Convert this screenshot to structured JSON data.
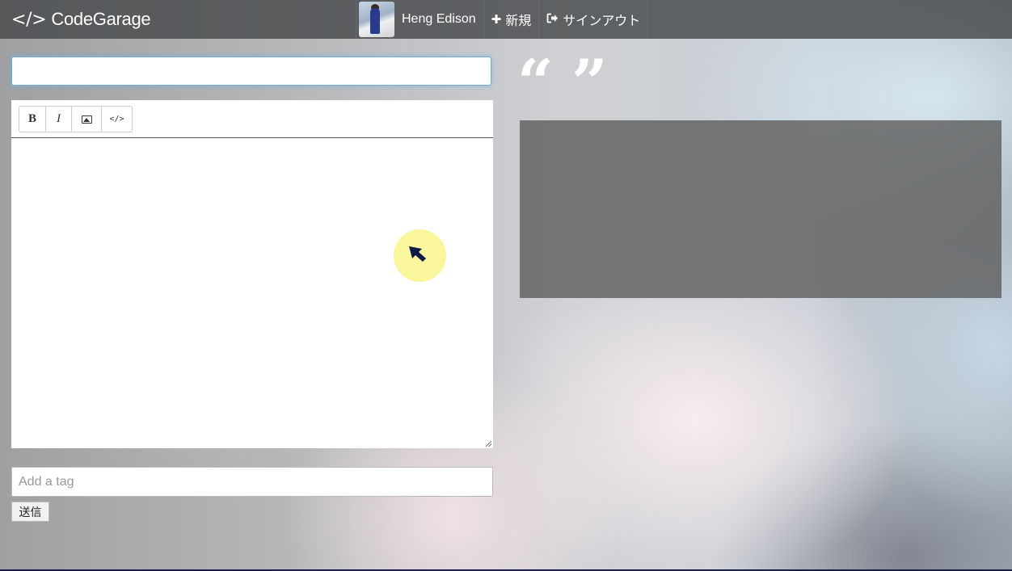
{
  "navbar": {
    "brand_icon": "</>",
    "brand_name": "CodeGarage",
    "user_name": "Heng Edison",
    "new_label": "新規",
    "signout_label": "サインアウト",
    "new_icon": "plus-icon",
    "signout_icon": "sign-out-icon"
  },
  "editor": {
    "title_value": "",
    "toolbar": {
      "bold": "B",
      "italic": "I",
      "image": "image-icon",
      "code": "</>"
    },
    "body_value": ""
  },
  "tags": {
    "placeholder": "Add a tag"
  },
  "submit_label": "送信",
  "preview": {
    "quote_open": "“",
    "quote_close": "”"
  },
  "colors": {
    "navbar": "#464849",
    "focus_border": "#66afe9",
    "cursor_halo": "#faf696",
    "cursor_arrow": "#0e1a4a"
  }
}
